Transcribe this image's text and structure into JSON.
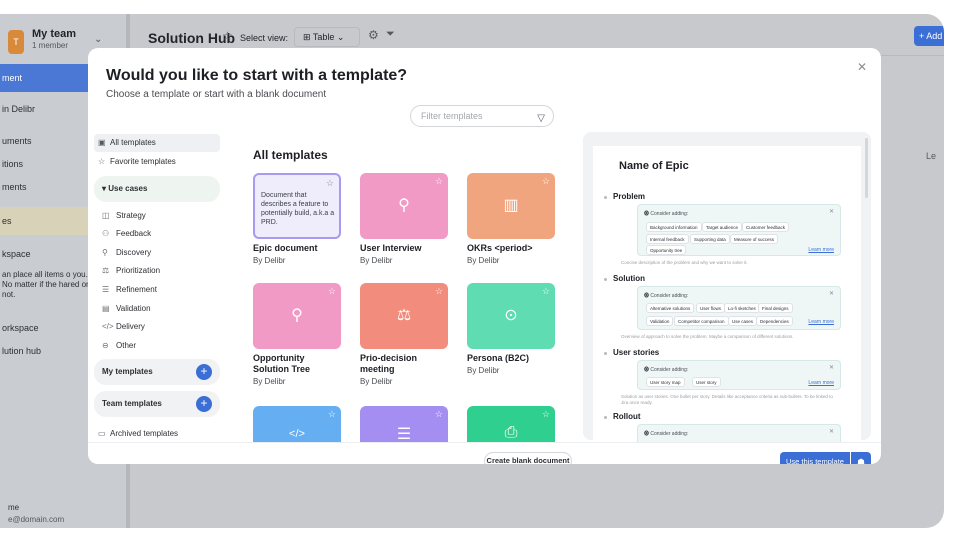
{
  "app": {
    "team_name": "My team",
    "team_sub": "1 member",
    "team_initial": "T",
    "header_title": "Solution Hub",
    "select_view_label": "Select view:",
    "view_value": "Table",
    "add_label": "+ Add",
    "right_letter": "Le",
    "footer_name": "me",
    "footer_email": "e@domain.com",
    "sidebar": {
      "item1": "ment",
      "item2": "in Delibr",
      "item3": "uments",
      "item4": "itions",
      "item5": "ments",
      "item6": "es",
      "item7": "kspace",
      "note": "an place all items o you. No matter if the hared or not.",
      "item8": "orkspace",
      "item9": "lution hub"
    }
  },
  "modal": {
    "title": "Would you like to start with a template?",
    "subtitle": "Choose a template or start with a blank document",
    "filter_placeholder": "Filter templates",
    "nav": {
      "all": "All templates",
      "favorite": "Favorite templates",
      "use_cases": "Use cases",
      "sub": [
        "Strategy",
        "Feedback",
        "Discovery",
        "Prioritization",
        "Refinement",
        "Validation",
        "Delivery",
        "Other"
      ],
      "my_templates": "My templates",
      "team_templates": "Team templates",
      "archived": "Archived templates"
    },
    "section_title": "All templates",
    "cards": [
      {
        "name": "Epic document",
        "by": "By Delibr",
        "desc": "Document that describes a feature to potentially build, a.k.a a PRD.",
        "color": "#efecfb"
      },
      {
        "name": "User Interview",
        "by": "By Delibr",
        "color": "#f29ac6"
      },
      {
        "name": "OKRs <period>",
        "by": "By Delibr",
        "color": "#f0a57f"
      },
      {
        "name": "Opportunity Solution Tree",
        "by": "By Delibr",
        "color": "#f29ac6"
      },
      {
        "name": "Prio-decision meeting",
        "by": "By Delibr",
        "color": "#f28c7c"
      },
      {
        "name": "Persona (B2C)",
        "by": "By Delibr",
        "color": "#5fdcb2"
      },
      {
        "color": "#66aef2"
      },
      {
        "color": "#a48ef2"
      },
      {
        "color": "#2fd08f"
      }
    ],
    "preview": {
      "title": "Name of Epic",
      "consider": "Consider adding:",
      "learn_more": "Learn more",
      "problem": "Problem",
      "problem_tags": [
        "Background information",
        "Target audience",
        "Customer feedback",
        "Internal feedback",
        "Supporting data",
        "Measure of success",
        "Opportunity tree"
      ],
      "problem_note": "Concise description of the problem and why we want to solve it.",
      "solution": "Solution",
      "solution_tags": [
        "Alternative solutions",
        "User flows",
        "Lo-fi sketches",
        "Final designs",
        "Validation",
        "Competitor comparison",
        "Use cases",
        "Dependencies"
      ],
      "solution_note": "Overview of approach to solve the problem. Maybe a comparison of different solutions.",
      "user_stories": "User stories",
      "us_tags": [
        "User story map",
        "User story"
      ],
      "us_note": "Solution as user stories. One bullet per story. Details like acceptance criteria as sub-bullets. To be linked to Jira once ready.",
      "rollout": "Rollout"
    },
    "create_blank": "Create blank document",
    "use_template": "Use this template"
  }
}
